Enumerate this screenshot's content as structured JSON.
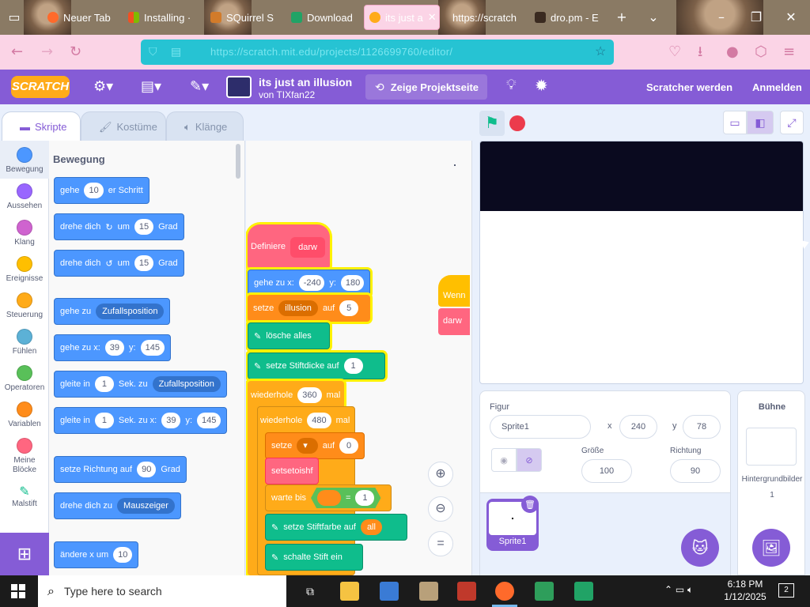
{
  "browser": {
    "tabs": [
      {
        "label": "Neuer Tab",
        "icon": "firefox-icon"
      },
      {
        "label": "Installing ·",
        "icon": "windows-icon"
      },
      {
        "label": "SQuirrel S",
        "icon": "squirrel-icon"
      },
      {
        "label": "Download",
        "icon": "download-icon"
      },
      {
        "label": "its just a",
        "icon": "scratch-icon",
        "active": true
      },
      {
        "label": "https://scratch",
        "icon": ""
      },
      {
        "label": "dro.pm - E",
        "icon": "dro-icon"
      }
    ],
    "url": "https://scratch.mit.edu/projects/1126699760/editor/"
  },
  "menu": {
    "logo": "SCRATCH",
    "project_title": "its just an illusion",
    "author": "von TIXfan22",
    "see_project": "Zeige Projektseite",
    "join": "Scratcher werden",
    "login": "Anmelden"
  },
  "editor_tabs": {
    "code": "Skripte",
    "costumes": "Kostüme",
    "sounds": "Klänge"
  },
  "categories": [
    {
      "label": "Bewegung",
      "color": "#4c97ff"
    },
    {
      "label": "Aussehen",
      "color": "#9966ff"
    },
    {
      "label": "Klang",
      "color": "#cf63cf"
    },
    {
      "label": "Ereignisse",
      "color": "#ffbf00"
    },
    {
      "label": "Steuerung",
      "color": "#ffab19"
    },
    {
      "label": "Fühlen",
      "color": "#5cb1d6"
    },
    {
      "label": "Operatoren",
      "color": "#59c059"
    },
    {
      "label": "Variablen",
      "color": "#ff8c1a"
    },
    {
      "label": "Meine Blöcke",
      "color": "#ff6680"
    },
    {
      "label": "Malstift",
      "color": "#0fbd8c"
    }
  ],
  "palette": {
    "heading": "Bewegung",
    "move": {
      "a": "gehe",
      "v": "10",
      "b": "er Schritt"
    },
    "turn_right": {
      "a": "drehe dich",
      "b": "um",
      "v": "15",
      "c": "Grad"
    },
    "turn_left": {
      "a": "drehe dich",
      "b": "um",
      "v": "15",
      "c": "Grad"
    },
    "goto": {
      "a": "gehe zu",
      "d": "Zufallsposition"
    },
    "goto_xy": {
      "a": "gehe zu x:",
      "x": "39",
      "b": "y:",
      "y": "145"
    },
    "glide": {
      "a": "gleite in",
      "v": "1",
      "b": "Sek. zu",
      "d": "Zufallsposition"
    },
    "glide_xy": {
      "a": "gleite in",
      "v": "1",
      "b": "Sek. zu x:",
      "x": "39",
      "c": "y:",
      "y": "145"
    },
    "point": {
      "a": "setze Richtung auf",
      "v": "90",
      "b": "Grad"
    },
    "point_towards": {
      "a": "drehe dich zu",
      "d": "Mauszeiger"
    },
    "change_x": {
      "a": "ändere x um",
      "v": "10"
    }
  },
  "script": {
    "define": "Definiere",
    "define_name": "darw",
    "goto": {
      "a": "gehe zu x:",
      "x": "-240",
      "b": "y:",
      "y": "180"
    },
    "set_var": {
      "a": "setze",
      "d": "illusion",
      "b": "auf",
      "v": "5"
    },
    "clear": "lösche alles",
    "pen_size": {
      "a": "setze Stiftdicke auf",
      "v": "1"
    },
    "repeat_outer": {
      "a": "wiederhole",
      "v": "360",
      "b": "mal"
    },
    "repeat_inner": {
      "a": "wiederhole",
      "v": "480",
      "b": "mal"
    },
    "set_blank": {
      "a": "setze",
      "b": "auf",
      "v": "0"
    },
    "call": "setsetoishf",
    "wait_until": {
      "a": "warte bis",
      "eq": "=",
      "v": "1"
    },
    "pen_color": {
      "a": "setze Stiftfarbe auf",
      "v": "all"
    },
    "pen_down": "schalte Stift ein",
    "side_wenn": "Wenn",
    "side_darw": "darw"
  },
  "sprite_info": {
    "label": "Figur",
    "name": "Sprite1",
    "x_label": "x",
    "x": "240",
    "y_label": "y",
    "y": "78",
    "size_label": "Größe",
    "size": "100",
    "dir_label": "Richtung",
    "dir": "90",
    "thumb_label": "Sprite1"
  },
  "stage_panel": {
    "title": "Bühne",
    "backdrops_label": "Hintergrundbilder",
    "backdrops_count": "1"
  },
  "taskbar": {
    "search": "Type here to search",
    "time": "6:18 PM",
    "date": "1/12/2025",
    "notif": "2"
  }
}
